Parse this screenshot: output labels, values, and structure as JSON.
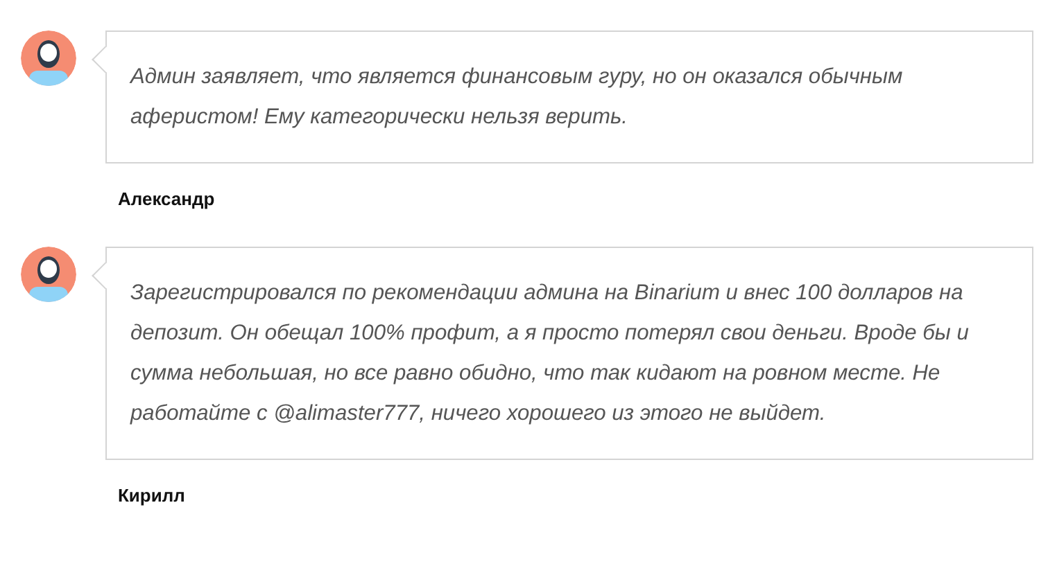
{
  "comments": [
    {
      "text": "Админ заявляет, что является финансовым гуру, но он оказался обычным аферистом! Ему категорически нельзя верить.",
      "author": "Александр"
    },
    {
      "text": "Зарегистрировался по рекомендации админа на Binarium и внес 100 долларов на депозит. Он обещал 100% профит, а я просто потерял свои деньги. Вроде бы и сумма небольшая, но все равно обидно, что так кидают на ровном месте. Не работайте с @alimaster777, ничего хорошего из этого не выйдет.",
      "author": "Кирилл"
    }
  ]
}
